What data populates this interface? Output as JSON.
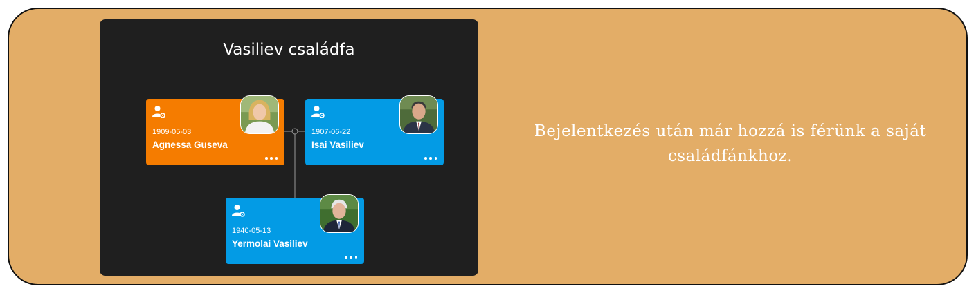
{
  "tree": {
    "title": "Vasiliev családfa",
    "people": [
      {
        "date": "1909-05-03",
        "name": "Agnessa Guseva",
        "gender": "female"
      },
      {
        "date": "1907-06-22",
        "name": "Isai Vasiliev",
        "gender": "male"
      },
      {
        "date": "1940-05-13",
        "name": "Yermolai Vasiliev",
        "gender": "male"
      }
    ]
  },
  "caption": "Bejelentkezés után már hozzá is férünk a saját családfánkhoz.",
  "colors": {
    "background": "#e3ad67",
    "panel": "#1f1f1f",
    "female_card": "#f57c00",
    "male_card": "#039be5"
  },
  "icons": [
    "person-settings-icon",
    "more-dots-icon"
  ]
}
